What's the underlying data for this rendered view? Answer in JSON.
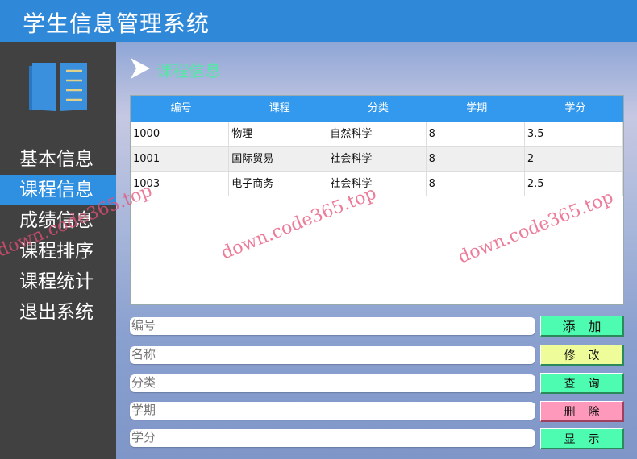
{
  "header": {
    "title": "学生信息管理系统"
  },
  "sidebar": {
    "items": [
      {
        "label": "基本信息"
      },
      {
        "label": "课程信息",
        "active": true
      },
      {
        "label": "成绩信息"
      },
      {
        "label": "课程排序"
      },
      {
        "label": "课程统计"
      },
      {
        "label": "退出系统"
      }
    ]
  },
  "page": {
    "title": "课程信息"
  },
  "table": {
    "headers": [
      "编号",
      "课程",
      "分类",
      "学期",
      "学分"
    ],
    "rows": [
      [
        "1000",
        "物理",
        "自然科学",
        "8",
        "3.5"
      ],
      [
        "1001",
        "国际贸易",
        "社会科学",
        "8",
        "2"
      ],
      [
        "1003",
        "电子商务",
        "社会科学",
        "8",
        "2.5"
      ]
    ]
  },
  "form": {
    "fields": [
      {
        "placeholder": "编号"
      },
      {
        "placeholder": "名称"
      },
      {
        "placeholder": "分类"
      },
      {
        "placeholder": "学期"
      },
      {
        "placeholder": "学分"
      }
    ],
    "buttons": [
      {
        "label": "添加",
        "color": "#4dfcb0"
      },
      {
        "label": "修改",
        "color": "#eefc9a"
      },
      {
        "label": "查询",
        "color": "#4dfcb0"
      },
      {
        "label": "删除",
        "color": "#ff99bb"
      },
      {
        "label": "显示",
        "color": "#4dfcb0"
      }
    ]
  },
  "watermark": "down.code365.top"
}
